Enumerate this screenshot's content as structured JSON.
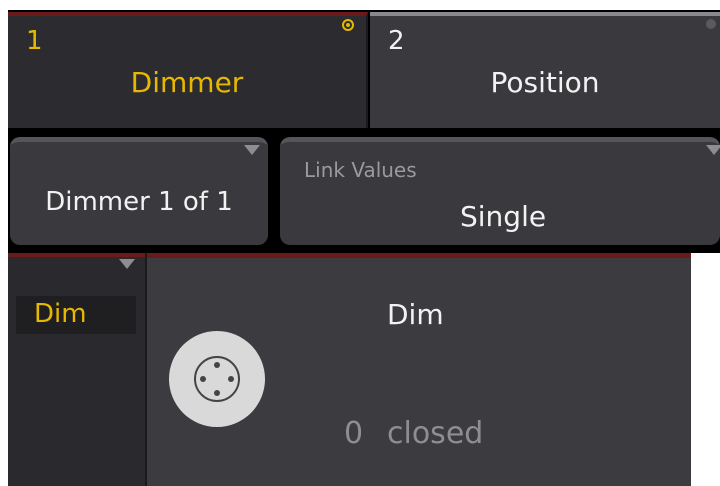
{
  "tabs": [
    {
      "number": "1",
      "label": "Dimmer",
      "active": true
    },
    {
      "number": "2",
      "label": "Position",
      "active": false
    }
  ],
  "feature_select": {
    "label": "Dimmer 1 of 1"
  },
  "link_values": {
    "caption": "Link Values",
    "value": "Single"
  },
  "attribute_list": {
    "items": [
      "Dim"
    ],
    "selected": "Dim"
  },
  "encoder": {
    "name": "Dim",
    "value": "0",
    "state": "closed"
  },
  "colors": {
    "accent": "#e6b800",
    "tab_active_bar": "#6b1a1a",
    "panel": "#3a3a3e"
  },
  "icons": [
    "dial-icon",
    "dropdown-arrow-icon",
    "status-dot-icon"
  ]
}
